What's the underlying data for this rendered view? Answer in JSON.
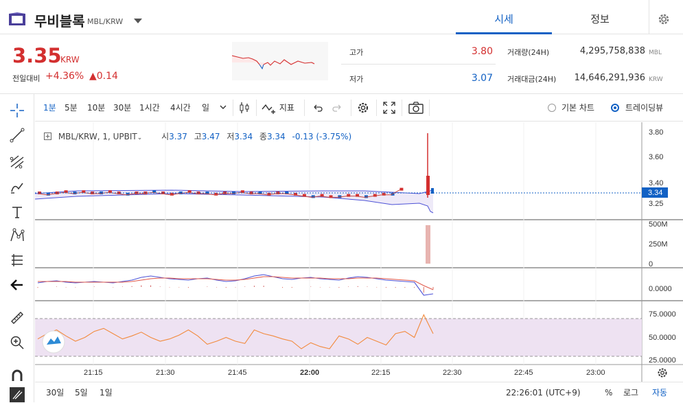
{
  "header": {
    "coin_name": "무비블록",
    "coin_pair": "MBL/KRW",
    "tabs": [
      {
        "label": "시세",
        "active": true
      },
      {
        "label": "정보",
        "active": false
      }
    ]
  },
  "summary": {
    "price": "3.35",
    "price_unit": "KRW",
    "change_label": "전일대비",
    "change_pct": "+4.36%",
    "change_abs": "▲0.14",
    "high_label": "고가",
    "high_value": "3.80",
    "low_label": "저가",
    "low_value": "3.07",
    "volume_label": "거래량(24H)",
    "volume_value": "4,295,758,838",
    "volume_unit": "MBL",
    "amount_label": "거래대금(24H)",
    "amount_value": "14,646,291,936",
    "amount_unit": "KRW",
    "colors": {
      "up": "#d32f2f",
      "down": "#1261c4"
    }
  },
  "toolbar": {
    "intervals": [
      {
        "label": "1분",
        "active": true
      },
      {
        "label": "5분"
      },
      {
        "label": "10분"
      },
      {
        "label": "30분"
      },
      {
        "label": "1시간"
      },
      {
        "label": "4시간"
      },
      {
        "label": "일"
      }
    ],
    "indicators_label": "지표",
    "chart_modes": [
      {
        "label": "기본 차트",
        "selected": false
      },
      {
        "label": "트레이딩뷰",
        "selected": true
      }
    ]
  },
  "legend": {
    "symbol": "MBL/KRW, 1, UPBIT",
    "open_label": "시",
    "open": "3.37",
    "high_label": "고",
    "high": "3.47",
    "low_label": "저",
    "low": "3.34",
    "close_label": "종",
    "close": "3.34",
    "change": "-0.13 (-3.75%)"
  },
  "chart_data": {
    "type": "line",
    "x_ticks": [
      "21:15",
      "21:30",
      "21:45",
      "22:00",
      "22:15",
      "22:30",
      "22:45",
      "23:00"
    ],
    "price_axis": [
      "3.80",
      "3.60",
      "3.40",
      "3.25"
    ],
    "current_price_tag": "3.34",
    "volume_axis": [
      "500M",
      "250M",
      "0"
    ],
    "macd_axis": [
      "0.0000"
    ],
    "rsi_axis": [
      "75.0000",
      "50.0000",
      "25.0000"
    ],
    "price_series": [
      3.34,
      3.33,
      3.34,
      3.35,
      3.34,
      3.35,
      3.34,
      3.34,
      3.35,
      3.34,
      3.33,
      3.34,
      3.34,
      3.35,
      3.34,
      3.33,
      3.34,
      3.35,
      3.34,
      3.34,
      3.33,
      3.34,
      3.34,
      3.35,
      3.34,
      3.34,
      3.33,
      3.34,
      3.34,
      3.33,
      3.32,
      3.31,
      3.32,
      3.31,
      3.31,
      3.32,
      3.32,
      3.31,
      3.32,
      3.33,
      3.33,
      3.37,
      3.47,
      3.34
    ],
    "spike_high": 3.8,
    "rsi_series": [
      48,
      55,
      60,
      52,
      45,
      50,
      58,
      62,
      55,
      48,
      52,
      57,
      50,
      45,
      48,
      53,
      60,
      52,
      41,
      45,
      50,
      45,
      42,
      60,
      55,
      52,
      48,
      45,
      35,
      43,
      38,
      35,
      52,
      48,
      41,
      50,
      45,
      40,
      55,
      58,
      50,
      80,
      55
    ]
  },
  "bottom": {
    "ranges": [
      "30일",
      "5일",
      "1일"
    ],
    "time": "22:26:01 (UTC+9)",
    "pct": "%",
    "log": "로그",
    "auto": "자동"
  }
}
